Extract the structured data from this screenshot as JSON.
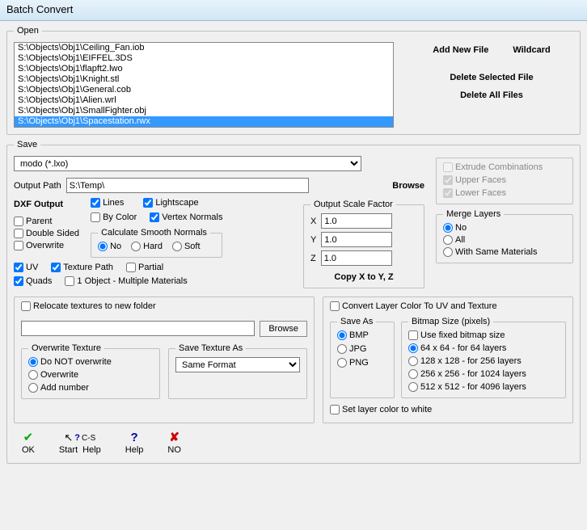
{
  "title": "Batch Convert",
  "open": {
    "legend": "Open",
    "files": [
      "S:\\Objects\\Obj1\\Ceiling_Fan.iob",
      "S:\\Objects\\Obj1\\EIFFEL.3DS",
      "S:\\Objects\\Obj1\\flapft2.lwo",
      "S:\\Objects\\Obj1\\Knight.stl",
      "S:\\Objects\\Obj1\\General.cob",
      "S:\\Objects\\Obj1\\Alien.wrl",
      "S:\\Objects\\Obj1\\SmallFighter.obj",
      "S:\\Objects\\Obj1\\Spacestation.rwx"
    ],
    "selectedIndex": 7,
    "addNew": "Add New File",
    "wildcard": "Wildcard",
    "delSel": "Delete Selected File",
    "delAll": "Delete All Files"
  },
  "save": {
    "legend": "Save",
    "format": "modo (*.lxo)",
    "outputPathLabel": "Output Path",
    "outputPath": "S:\\Temp\\",
    "browse": "Browse",
    "dxf": {
      "heading": "DXF Output",
      "parent": "Parent",
      "doubleSided": "Double Sided",
      "overwrite": "Overwrite",
      "uv": "UV",
      "texturePath": "Texture Path",
      "partial": "Partial",
      "quads": "Quads",
      "oneObj": "1 Object - Multiple Materials",
      "lines": "Lines",
      "byColor": "By Color",
      "lightscape": "Lightscape",
      "vertexNormals": "Vertex Normals",
      "calcLegend": "Calculate Smooth Normals",
      "no": "No",
      "hard": "Hard",
      "soft": "Soft"
    },
    "scale": {
      "legend": "Output Scale Factor",
      "x": "1.0",
      "y": "1.0",
      "z": "1.0",
      "xl": "X",
      "yl": "Y",
      "zl": "Z",
      "copy": "Copy X to Y, Z"
    },
    "extrudeLegend": "",
    "extrude": "Extrude Combinations",
    "upper": "Upper Faces",
    "lower": "Lower Faces",
    "merge": {
      "legend": "Merge Layers",
      "no": "No",
      "all": "All",
      "same": "With Same Materials"
    },
    "tex": {
      "relocate": "Relocate textures to new folder",
      "browse": "Browse",
      "owLegend": "Overwrite Texture",
      "owNo": "Do NOT overwrite",
      "owYes": "Overwrite",
      "owAdd": "Add number",
      "saveAsTexLegend": "Save Texture As",
      "saveAsTex": "Same Format"
    },
    "conv": {
      "convertLayer": "Convert Layer Color To UV and Texture",
      "saveAsLegend": "Save As",
      "bmp": "BMP",
      "jpg": "JPG",
      "png": "PNG",
      "bmLegend": "Bitmap Size (pixels)",
      "fixed": "Use fixed bitmap size",
      "s64": "64 x 64     - for     64 layers",
      "s128": "128 x 128 - for   256 layers",
      "s256": "256 x 256 - for 1024 layers",
      "s512": "512 x 512 - for 4096 layers",
      "setWhite": "Set layer color to white"
    }
  },
  "buttons": {
    "ok": "OK",
    "csHelp": "C-S\nHelp",
    "help": "Help",
    "no": "NO",
    "start": "Start"
  }
}
